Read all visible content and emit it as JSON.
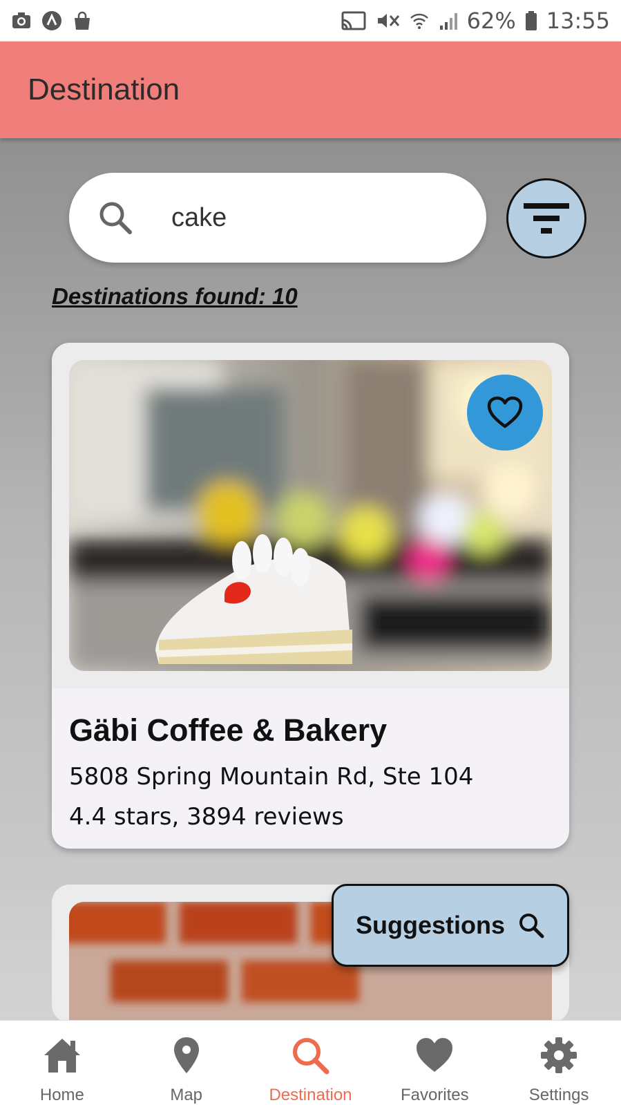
{
  "status_bar": {
    "battery": "62%",
    "time": "13:55"
  },
  "app_bar": {
    "title": "Destination"
  },
  "search": {
    "value": "cake"
  },
  "results": {
    "found_label": "Destinations found: 10"
  },
  "cards": [
    {
      "name": "Gäbi Coffee & Bakery",
      "address": "5808 Spring Mountain Rd, Ste 104",
      "rating": "4.4 stars, 3894 reviews"
    }
  ],
  "suggestions_button": {
    "label": "Suggestions"
  },
  "bottom_nav": {
    "items": [
      {
        "label": "Home",
        "icon": "home-icon"
      },
      {
        "label": "Map",
        "icon": "map-pin-icon"
      },
      {
        "label": "Destination",
        "icon": "search-icon",
        "active": true
      },
      {
        "label": "Favorites",
        "icon": "heart-icon"
      },
      {
        "label": "Settings",
        "icon": "gear-icon"
      }
    ]
  },
  "colors": {
    "app_bar": "#f07f7c",
    "accent_blue": "#b7cfe2",
    "favorite_button": "#3398d8",
    "active_nav": "#ef6b4e"
  }
}
